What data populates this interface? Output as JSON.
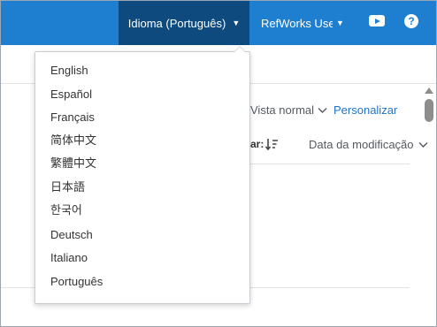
{
  "header": {
    "language_button": "Idioma (Português)",
    "user_menu": "RefWorks User",
    "help_icon": "?"
  },
  "toolbar": {
    "view_mode": "Vista normal",
    "customize_link": "Personalizar",
    "sort_label": "ar:",
    "sort_field": "Data da modificação"
  },
  "language_menu": {
    "items": [
      {
        "label": "English"
      },
      {
        "label": "Español"
      },
      {
        "label": "Français"
      },
      {
        "label": "简体中文"
      },
      {
        "label": "繁體中文"
      },
      {
        "label": "日本語"
      },
      {
        "label": "한국어"
      },
      {
        "label": "Deutsch"
      },
      {
        "label": "Italiano"
      },
      {
        "label": "Português"
      }
    ]
  },
  "colors": {
    "topbar": "#1e7fd0",
    "active_nav": "#0f4a7e",
    "link": "#1e72c8"
  },
  "icons": [
    "caret-down-icon",
    "youtube-icon",
    "help-icon",
    "chevron-down-icon",
    "sort-direction-icon",
    "scroll-up-icon"
  ]
}
